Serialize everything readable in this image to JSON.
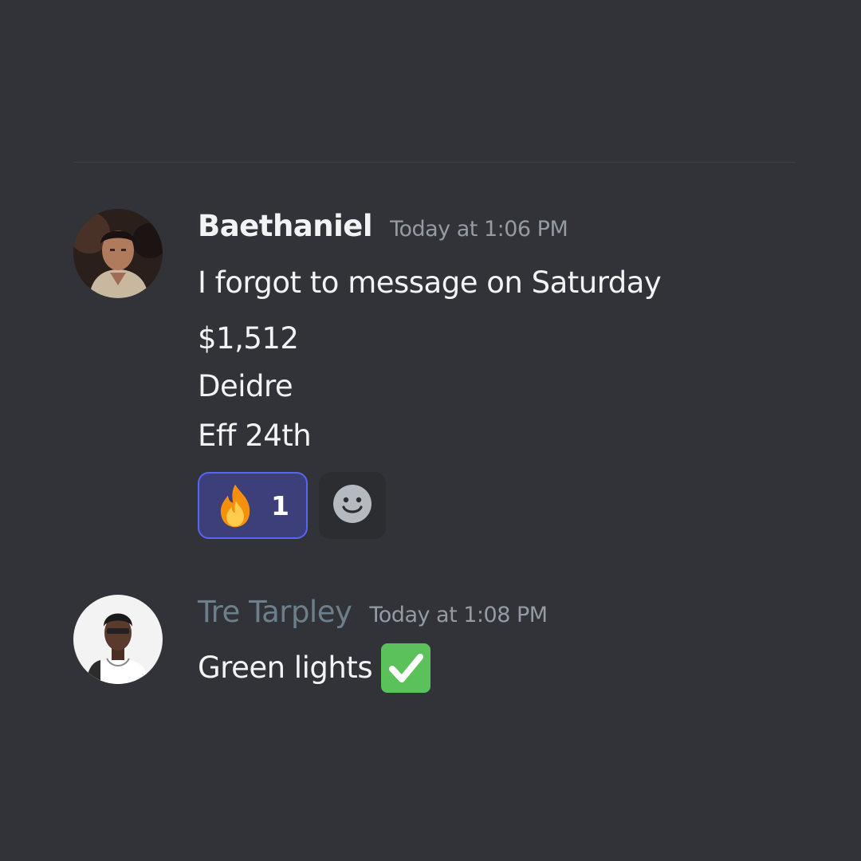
{
  "messages": [
    {
      "username": "Baethaniel",
      "timestamp": "Today at 1:06 PM",
      "avatar_icon": "user-avatar",
      "lines": [
        "I forgot to message on Saturday",
        "$1,512",
        "Deidre",
        "Eff 24th"
      ],
      "reactions": [
        {
          "emoji": "fire-icon",
          "count": "1"
        }
      ]
    },
    {
      "username": "Tre Tarpley",
      "timestamp": "Today at 1:08 PM",
      "avatar_icon": "user-avatar",
      "lines": [
        "Green lights"
      ],
      "trailing_emoji": "check-mark-button-icon"
    }
  ],
  "colors": {
    "background": "#313338",
    "username": "#f2f3f5",
    "username_muted": "#6d7f8a",
    "timestamp": "#949ba4",
    "reaction_border": "#5865f2",
    "reaction_bg": "#3c3f7a",
    "check_green": "#5ac15b"
  }
}
